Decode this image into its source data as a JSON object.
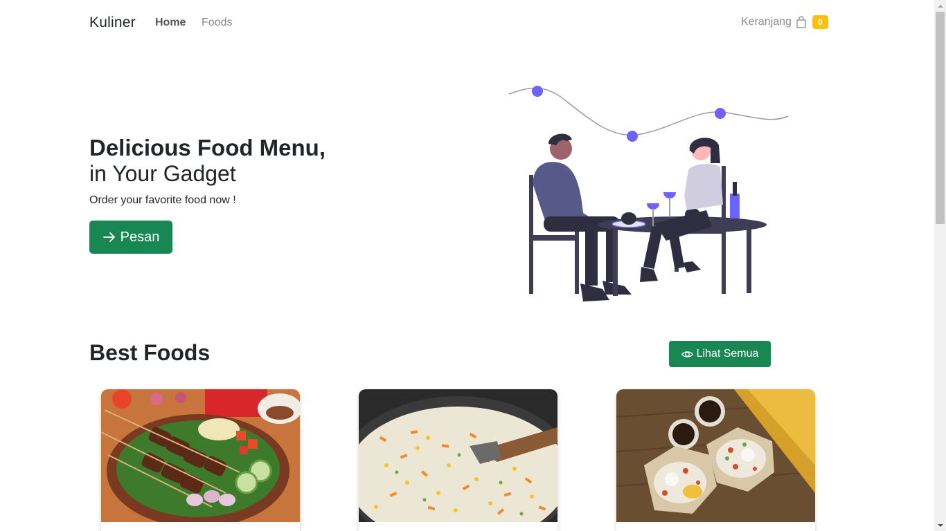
{
  "navbar": {
    "brand": "Kuliner",
    "links": [
      {
        "label": "Home",
        "active": true
      },
      {
        "label": "Foods",
        "active": false
      }
    ],
    "cart": {
      "label": "Keranjang",
      "icon": "bag-icon",
      "count": "0"
    }
  },
  "hero": {
    "title": "Delicious Food Menu,",
    "subtitle": "in Your Gadget",
    "description": "Order your favorite food now !",
    "button": {
      "label": "Pesan",
      "icon": "arrow-right-icon"
    },
    "illustration": "couple-dining-illustration"
  },
  "best_foods": {
    "title_prefix": "Best",
    "title_bold": "Foods",
    "view_all": {
      "label": "Lihat Semua",
      "icon": "eye-icon"
    },
    "cards": [
      {
        "image": "sate-skewers-photo"
      },
      {
        "image": "fried-rice-photo"
      },
      {
        "image": "nasi-bungkus-coffee-photo"
      }
    ]
  },
  "colors": {
    "primary_button": "#198754",
    "badge": "#ffc107",
    "illustration_accent": "#6c63ff",
    "text": "#212529"
  }
}
